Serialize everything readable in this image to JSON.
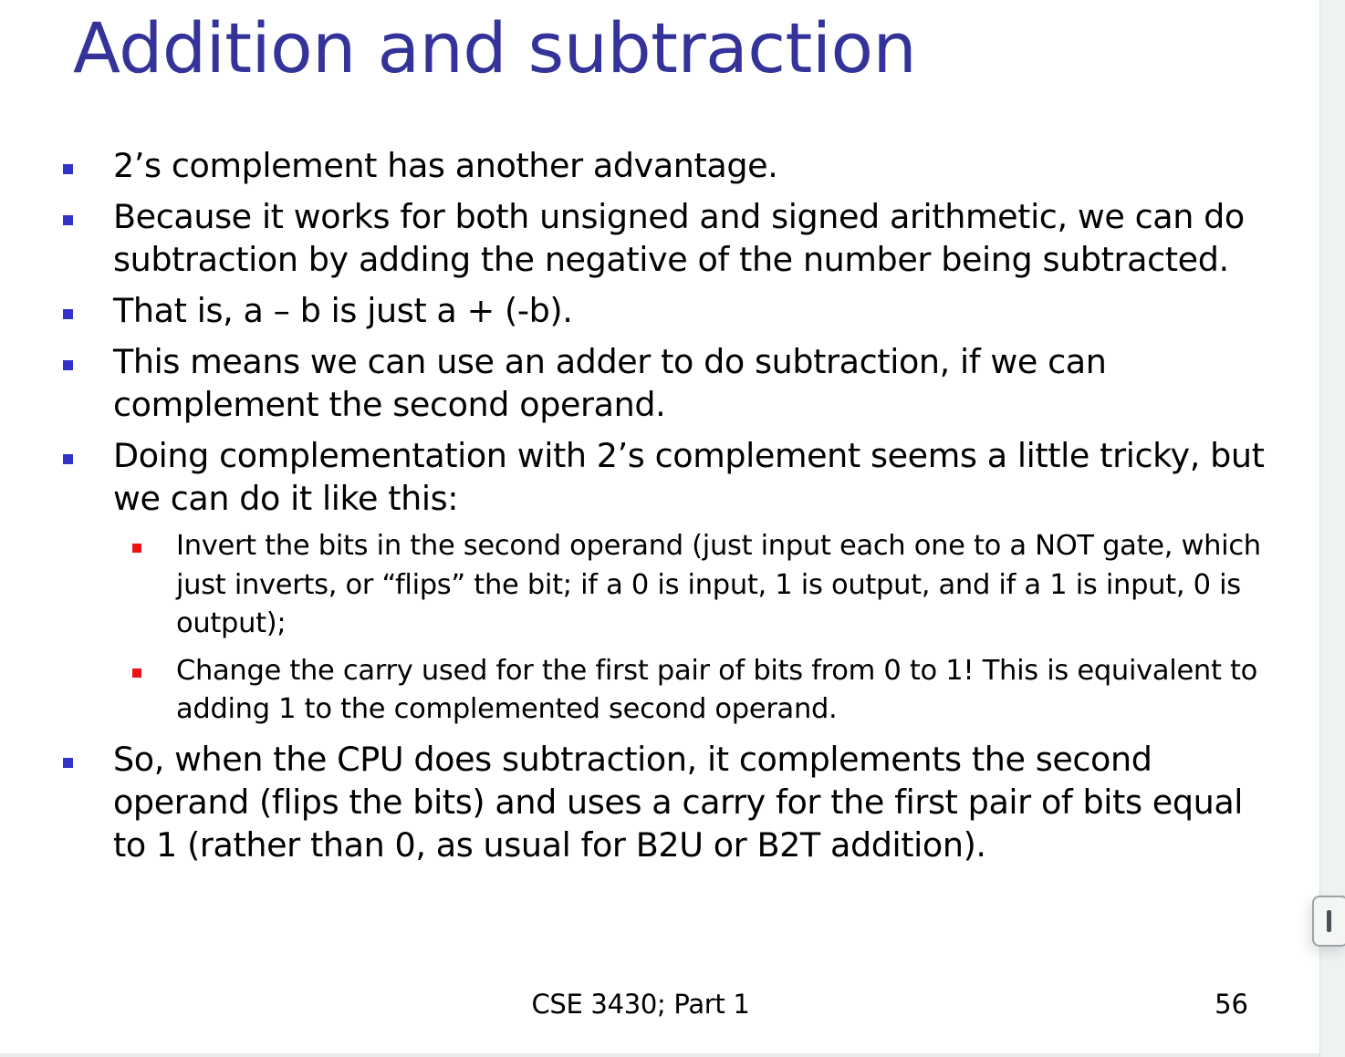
{
  "slide": {
    "title": "Addition and subtraction",
    "bullets": [
      {
        "text": "2’s complement has another advantage."
      },
      {
        "text": "Because it works for both unsigned and signed arithmetic, we can do subtraction by adding the negative of the number being subtracted."
      },
      {
        "text": "That is, a – b is just a + (-b)."
      },
      {
        "text": "This means we can use an adder to do subtraction, if we can complement the second operand."
      },
      {
        "text": "Doing complementation with 2’s complement seems a little tricky, but we can do it like this:",
        "sub": [
          {
            "text": "Invert the bits in the second operand (just input each one to a NOT gate, which just inverts, or “flips” the bit; if a 0 is input, 1 is output, and if a 1 is input, 0 is output);"
          },
          {
            "text": "Change the carry used for the first pair of bits from 0 to 1! This is equivalent to adding 1 to the complemented second operand."
          }
        ]
      },
      {
        "text": "So, when the CPU does subtraction, it complements the second operand (flips the bits) and uses a carry for the first pair of bits equal to 1 (rather than 0, as usual for B2U or B2T addition)."
      }
    ],
    "footer": {
      "center": "CSE 3430; Part 1",
      "page_number": "56"
    }
  },
  "colors": {
    "title": "#333399",
    "level1_bullet": "#3333cc",
    "level2_bullet": "#ee1111",
    "text": "#000000",
    "background": "#ffffff"
  },
  "icons": {
    "scroll_handle": "drag-handle-icon"
  }
}
